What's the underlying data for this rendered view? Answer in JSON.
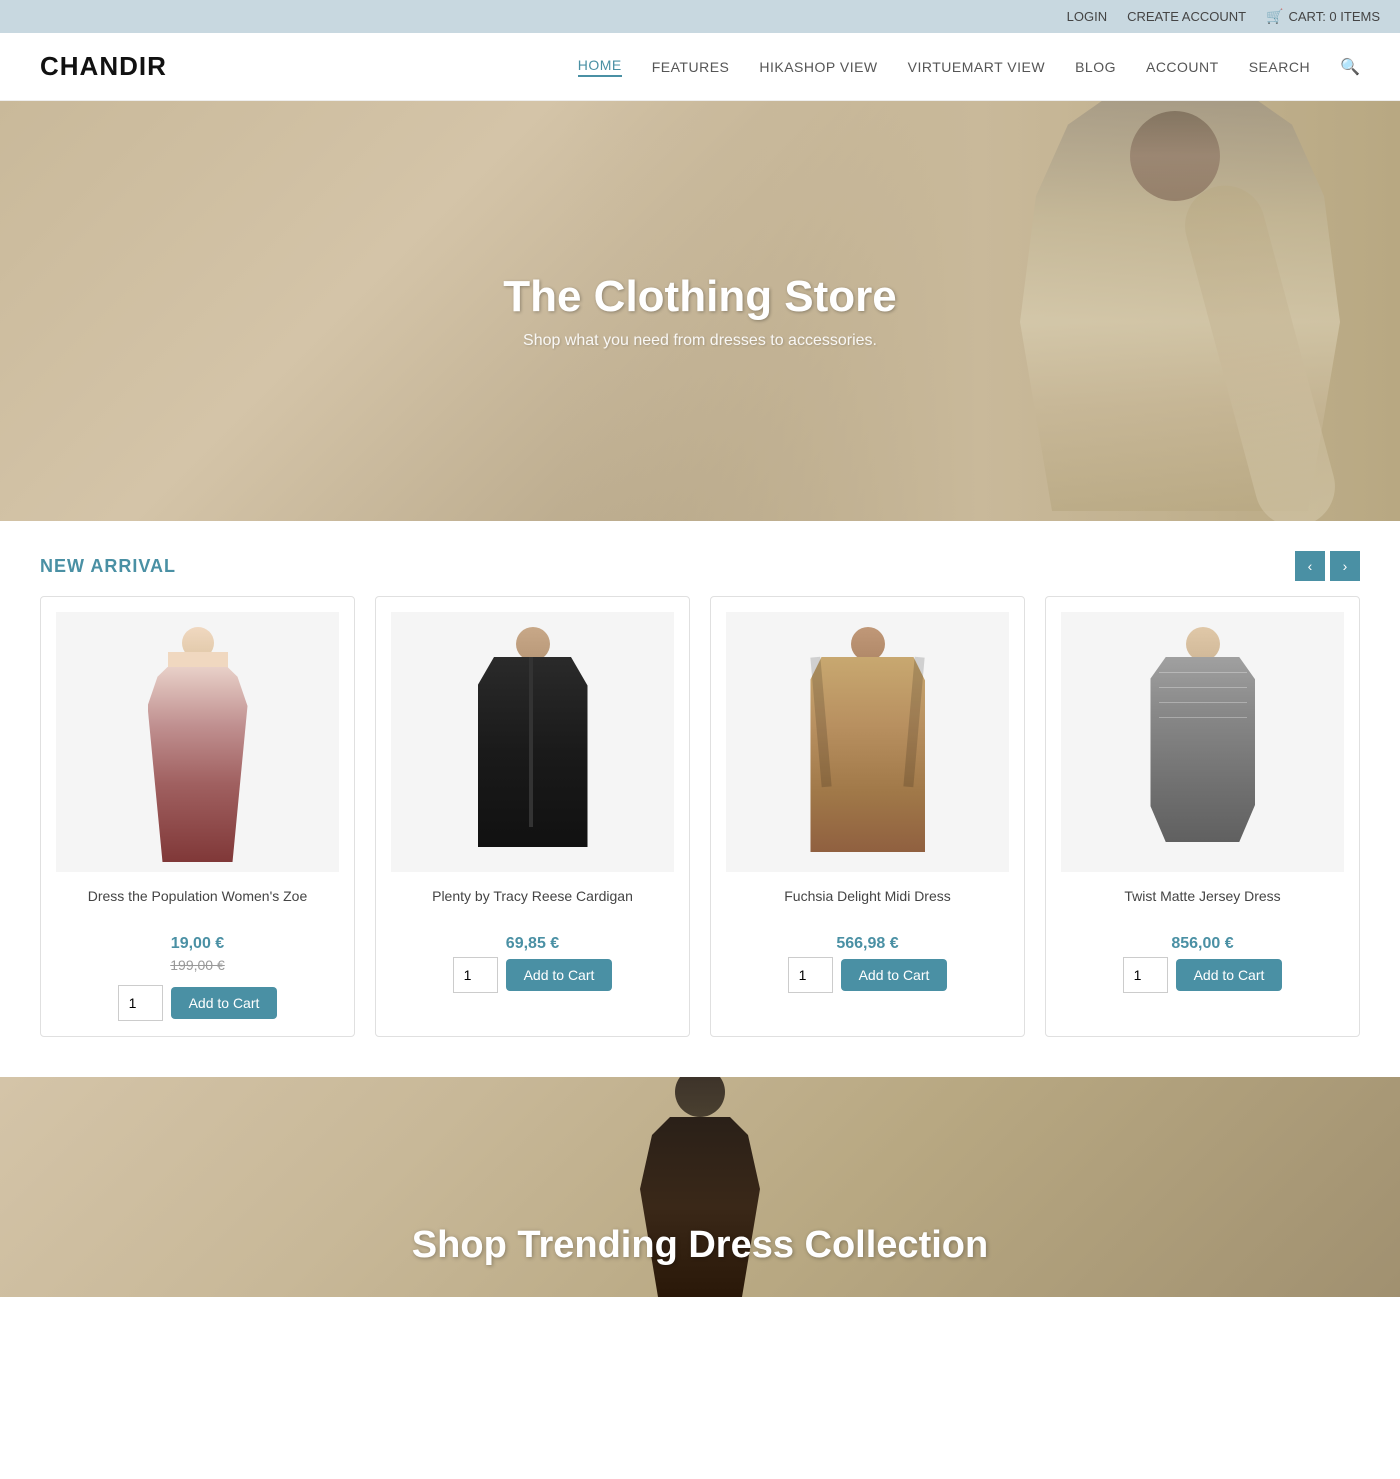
{
  "topbar": {
    "login": "LOGIN",
    "create_account": "CREATE ACCOUNT",
    "cart_label": "CART: 0 ITEMS"
  },
  "header": {
    "logo": "CHANDIR",
    "nav": [
      {
        "label": "HOME",
        "active": true
      },
      {
        "label": "FEATURES",
        "active": false
      },
      {
        "label": "HIKASHOP VIEW",
        "active": false
      },
      {
        "label": "VIRTUEMART VIEW",
        "active": false
      },
      {
        "label": "BLOG",
        "active": false
      },
      {
        "label": "ACCOUNT",
        "active": false
      },
      {
        "label": "SEARCH",
        "active": false
      }
    ]
  },
  "hero": {
    "title": "The Clothing Store",
    "subtitle": "Shop what you need from dresses to accessories."
  },
  "new_arrival": {
    "section_title": "NEW ARRIVAL",
    "prev_label": "‹",
    "next_label": "›",
    "products": [
      {
        "id": 1,
        "name": "Dress the Population Women's Zoe",
        "price_new": "19,00 €",
        "price_old": "199,00 €",
        "qty": "1",
        "add_to_cart": "Add to Cart",
        "style": "dress1"
      },
      {
        "id": 2,
        "name": "Plenty by Tracy Reese Cardigan",
        "price_new": "69,85 €",
        "price_old": null,
        "qty": "1",
        "add_to_cart": "Add to Cart",
        "style": "jacket"
      },
      {
        "id": 3,
        "name": "Fuchsia Delight Midi Dress",
        "price_new": "566,98 €",
        "price_old": null,
        "qty": "1",
        "add_to_cart": "Add to Cart",
        "style": "coat"
      },
      {
        "id": 4,
        "name": "Twist Matte Jersey Dress",
        "price_new": "856,00 €",
        "price_old": null,
        "qty": "1",
        "add_to_cart": "Add to Cart",
        "style": "cardigan"
      }
    ]
  },
  "bottom_banner": {
    "title": "Shop Trending Dress Collection"
  },
  "colors": {
    "accent": "#4a90a4",
    "top_bar_bg": "#c8d8e0"
  }
}
